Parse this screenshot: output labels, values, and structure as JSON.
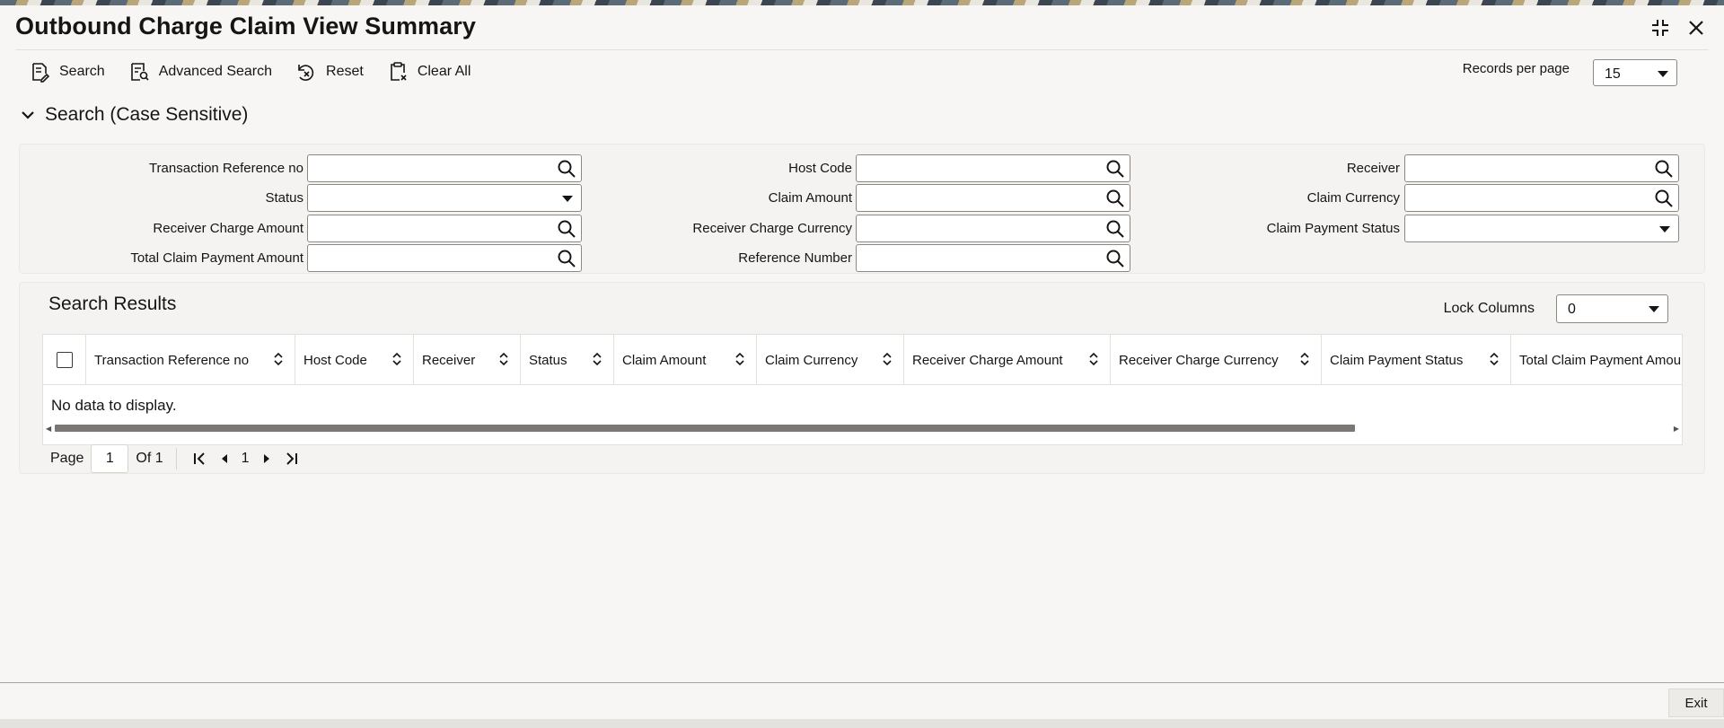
{
  "page": {
    "title": "Outbound Charge Claim View Summary"
  },
  "toolbar": {
    "search_label": "Search",
    "advanced_search_label": "Advanced Search",
    "reset_label": "Reset",
    "clear_all_label": "Clear All"
  },
  "records_per_page": {
    "label": "Records per page",
    "value": "15"
  },
  "search_section": {
    "title": "Search (Case Sensitive)"
  },
  "criteria": {
    "transaction_reference_no": {
      "label": "Transaction Reference no",
      "value": ""
    },
    "host_code": {
      "label": "Host Code",
      "value": ""
    },
    "receiver": {
      "label": "Receiver",
      "value": ""
    },
    "status": {
      "label": "Status",
      "value": ""
    },
    "claim_amount": {
      "label": "Claim Amount",
      "value": ""
    },
    "claim_currency": {
      "label": "Claim Currency",
      "value": ""
    },
    "receiver_charge_amount": {
      "label": "Receiver Charge Amount",
      "value": ""
    },
    "receiver_charge_currency": {
      "label": "Receiver Charge Currency",
      "value": ""
    },
    "claim_payment_status": {
      "label": "Claim Payment Status",
      "value": ""
    },
    "total_claim_payment_amount": {
      "label": "Total Claim Payment Amount",
      "value": ""
    },
    "reference_number": {
      "label": "Reference Number",
      "value": ""
    }
  },
  "results": {
    "title": "Search Results",
    "lock_columns_label": "Lock Columns",
    "lock_columns_value": "0",
    "columns": [
      "Transaction Reference no",
      "Host Code",
      "Receiver",
      "Status",
      "Claim Amount",
      "Claim Currency",
      "Receiver Charge Amount",
      "Receiver Charge Currency",
      "Claim Payment Status",
      "Total Claim Payment Amou"
    ],
    "empty_message": "No data to display.",
    "scroll_position": 0.0
  },
  "pagination": {
    "page_label": "Page",
    "current_page": "1",
    "of_label": "Of 1",
    "page_number": "1"
  },
  "footer": {
    "exit_label": "Exit"
  },
  "colors": {
    "accent_text": "#161513",
    "background": "#f7f6f4",
    "panel": "#f4f3f1"
  }
}
